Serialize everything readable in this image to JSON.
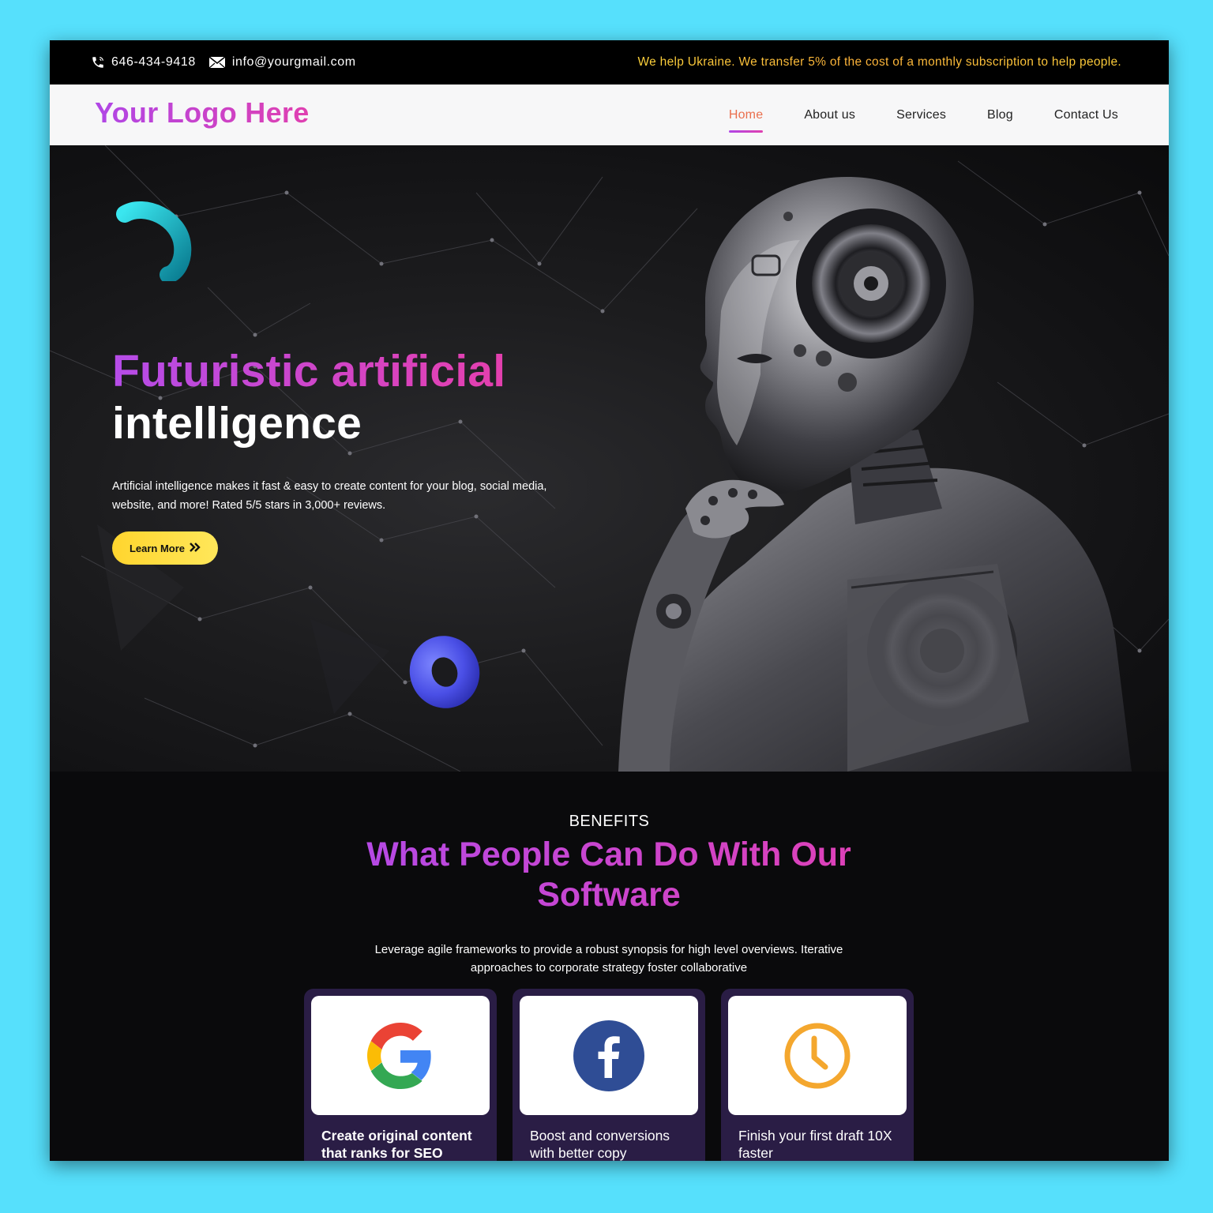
{
  "topbar": {
    "phone": "646-434-9418",
    "email": "info@yourgmail.com",
    "notice": "We help Ukraine. We transfer 5% of the cost of a monthly subscription to help people."
  },
  "nav": {
    "logo": "Your Logo Here",
    "items": [
      {
        "label": "Home",
        "active": true
      },
      {
        "label": "About us"
      },
      {
        "label": "Services"
      },
      {
        "label": "Blog"
      },
      {
        "label": "Contact Us"
      }
    ]
  },
  "hero": {
    "title_line1": "Futuristic artificial",
    "title_line2": "intelligence",
    "description": "Artificial intelligence makes it fast & easy to create content for your blog, social media, website, and more! Rated 5/5 stars in 3,000+ reviews.",
    "button_label": "Learn More"
  },
  "benefits": {
    "eyebrow": "BENEFITS",
    "heading": "What People Can Do With Our Software",
    "subtext": "Leverage agile frameworks to provide a robust synopsis for high level overviews. Iterative approaches to corporate strategy foster collaborative",
    "cards": [
      {
        "icon": "google-icon",
        "title": "Create original content that ranks for SEO"
      },
      {
        "icon": "facebook-icon",
        "title": "Boost and conversions with better copy"
      },
      {
        "icon": "clock-icon",
        "title": "Finish your first draft 10X faster"
      }
    ]
  },
  "colors": {
    "page_background": "#56e0fc",
    "accent_gradient_start": "#b046e6",
    "accent_gradient_end": "#e040b0",
    "button_yellow": "#ffd52e",
    "card_background": "#2a1d45",
    "nav_active": "#ea6f4d"
  }
}
